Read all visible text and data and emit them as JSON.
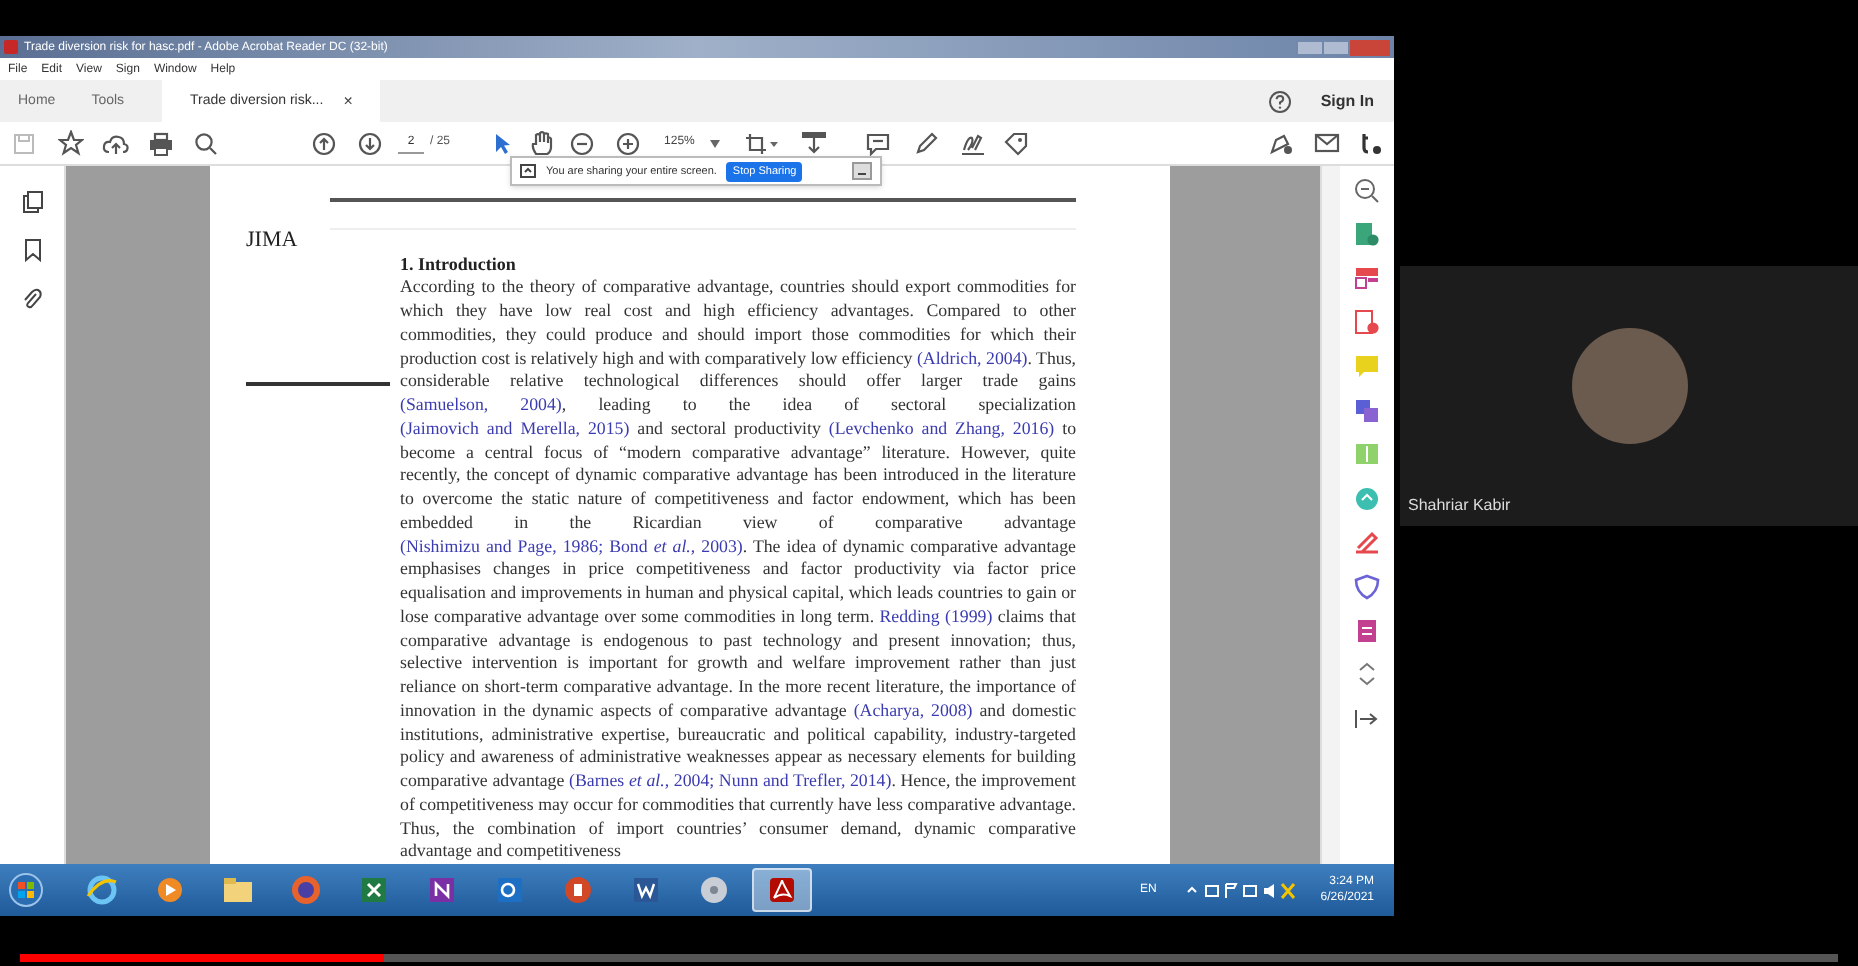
{
  "window": {
    "title": "Trade diversion risk for hasc.pdf - Adobe Acrobat Reader DC (32-bit)"
  },
  "menu": [
    "File",
    "Edit",
    "View",
    "Sign",
    "Window",
    "Help"
  ],
  "tabs": [
    {
      "label": "Home",
      "selected": false
    },
    {
      "label": "Tools",
      "selected": false
    },
    {
      "label": "Trade diversion risk...",
      "selected": true,
      "close": "×"
    }
  ],
  "sign_in": "Sign In",
  "toolbar": {
    "page_number": "2",
    "page_count": "/ 25",
    "zoom": "125%"
  },
  "share_banner": {
    "message": "You are sharing your entire screen.",
    "button": "Stop Sharing"
  },
  "document": {
    "journal": "JIMA",
    "heading": "1. Introduction",
    "paragraph": [
      {
        "kind": "plain",
        "text": "According to the theory of comparative advantage, countries should export commodities for which they have low real cost and high efficiency advantages. Compared to other commodities, they could produce and should import those commodities for which their production cost is relatively high and with comparatively low efficiency "
      },
      {
        "kind": "citation",
        "text": "(Aldrich, 2004)"
      },
      {
        "kind": "plain",
        "text": ". Thus, considerable relative technological differences should offer larger trade gains "
      },
      {
        "kind": "citation",
        "text": "(Samuelson, 2004)"
      },
      {
        "kind": "plain",
        "text": ", leading to the idea of sectoral specialization "
      },
      {
        "kind": "citation",
        "text": "(Jaimovich and Merella, 2015)"
      },
      {
        "kind": "plain",
        "text": " and sectoral productivity "
      },
      {
        "kind": "citation",
        "text": "(Levchenko and Zhang, 2016)"
      },
      {
        "kind": "plain",
        "text": " to become a central focus of “modern comparative advantage” literature. However, quite recently, the concept of dynamic comparative advantage has been introduced in the literature to overcome the static nature of competitiveness and factor endowment, which has been embedded in the Ricardian view of comparative advantage "
      },
      {
        "kind": "citation",
        "text": "(Nishimizu and Page, 1986; Bond *et al.*, 2003)"
      },
      {
        "kind": "plain",
        "text": ". The idea of dynamic comparative advantage emphasises changes in price competitiveness and factor productivity via factor price equalisation and improvements in human and physical capital, which leads countries to gain or lose comparative advantage over some commodities in long term. "
      },
      {
        "kind": "citation",
        "text": "Redding (1999)"
      },
      {
        "kind": "plain",
        "text": " claims that comparative advantage is endogenous to past technology and present innovation; thus, selective intervention is important for growth and welfare improvement rather than just reliance on short-term comparative advantage. In the more recent literature, the importance of innovation in the dynamic aspects of comparative advantage "
      },
      {
        "kind": "citation",
        "text": "(Acharya, 2008)"
      },
      {
        "kind": "plain",
        "text": " and domestic institutions, administrative expertise, bureaucratic and political capability, industry-targeted policy and awareness of administrative weaknesses appear as necessary elements for building comparative advantage "
      },
      {
        "kind": "citation",
        "text": "(Barnes *et al.*, 2004; Nunn and Trefler, 2014)"
      },
      {
        "kind": "plain",
        "text": ". Hence, the improvement of competitiveness may occur for commodities that currently have less comparative advantage. Thus, the combination of import countries’ consumer demand, dynamic comparative advantage and competitiveness"
      }
    ]
  },
  "taskbar": {
    "apps": [
      {
        "selected": false
      },
      {
        "selected": false
      },
      {
        "selected": false
      },
      {
        "selected": false
      },
      {
        "selected": false
      },
      {
        "selected": false
      },
      {
        "selected": false
      },
      {
        "selected": false
      },
      {
        "selected": false
      },
      {
        "selected": false
      },
      {
        "selected": true
      }
    ],
    "language": "EN",
    "time": "3:24 PM",
    "date": "6/26/2021"
  },
  "participant": {
    "name": "Shahriar Kabir"
  },
  "video_progress": {
    "level": 0.2
  }
}
